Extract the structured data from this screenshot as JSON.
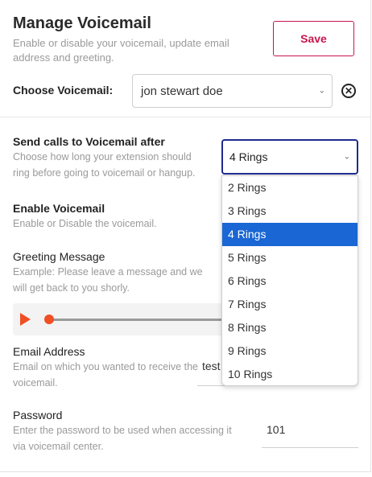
{
  "header": {
    "title": "Manage Voicemail",
    "subtitle": "Enable or disable your voicemail, update email address and greeting.",
    "save_label": "Save"
  },
  "choose": {
    "label": "Choose Voicemail:",
    "value": "jon stewart doe"
  },
  "send_calls": {
    "label": "Send calls to Voicemail after",
    "description": "Choose how long your extension should ring before going to voicemail or hangup.",
    "selected": "4 Rings",
    "options": [
      "2 Rings",
      "3 Rings",
      "4 Rings",
      "5 Rings",
      "6 Rings",
      "7 Rings",
      "8 Rings",
      "9 Rings",
      "10 Rings"
    ]
  },
  "enable": {
    "label": "Enable Voicemail",
    "description": "Enable or Disable the voicemail."
  },
  "greeting": {
    "label": "Greeting Message",
    "description": "Example: Please leave a message and we will get back to you shorly."
  },
  "email": {
    "label": "Email Address",
    "description": "Email on which you wanted to receive the voicemail.",
    "value": "test"
  },
  "password": {
    "label": "Password",
    "description": "Enter the password to be used when accessing it via voicemail center.",
    "value": "101"
  },
  "colors": {
    "accent": "#c8164e",
    "player": "#f04e23",
    "selected_option": "#1a66d4"
  }
}
